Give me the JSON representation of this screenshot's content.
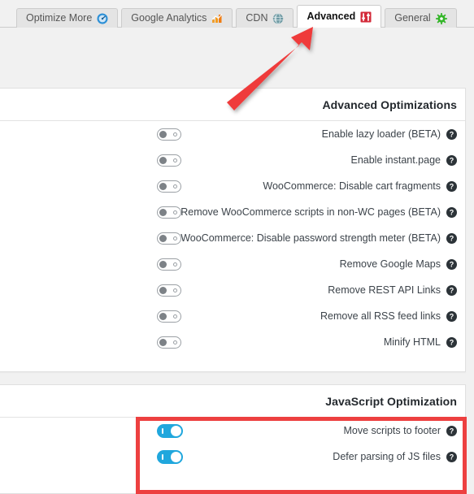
{
  "tabs": [
    {
      "label": "Optimize More",
      "icon": "speedometer-icon",
      "active": false
    },
    {
      "label": "Google Analytics",
      "icon": "chart-icon",
      "active": false
    },
    {
      "label": "CDN",
      "icon": "globe-icon",
      "active": false
    },
    {
      "label": "Advanced",
      "icon": "sliders-icon",
      "active": true
    },
    {
      "label": "General",
      "icon": "gear-icon",
      "active": false
    }
  ],
  "panels": [
    {
      "title": "Advanced Optimizations",
      "rows": [
        {
          "label": "Enable lazy loader (BETA)",
          "toggle": "off",
          "help": "help-icon"
        },
        {
          "label": "Enable instant.page",
          "toggle": "off",
          "help": "help-icon"
        },
        {
          "label": "WooCommerce: Disable cart fragments",
          "toggle": "off",
          "help": "help-icon"
        },
        {
          "label": "Remove WooCommerce scripts in non-WC pages (BETA)",
          "toggle": "off",
          "help": "help-icon"
        },
        {
          "label": "WooCommerce: Disable password strength meter (BETA)",
          "toggle": "off",
          "help": "help-icon"
        },
        {
          "label": "Remove Google Maps",
          "toggle": "off",
          "help": "help-icon"
        },
        {
          "label": "Remove REST API Links",
          "toggle": "off",
          "help": "help-icon"
        },
        {
          "label": "Remove all RSS feed links",
          "toggle": "off",
          "help": "help-icon"
        },
        {
          "label": "Minify HTML",
          "toggle": "off",
          "help": "help-icon"
        }
      ]
    },
    {
      "title": "JavaScript Optimization",
      "rows": [
        {
          "label": "Move scripts to footer",
          "toggle": "on",
          "help": "help-icon"
        },
        {
          "label": "Defer parsing of JS files",
          "toggle": "on",
          "help": "help-icon"
        }
      ]
    }
  ],
  "annotations": {
    "arrow": {
      "name": "red-arrow-annotation",
      "color": "#ef3b3b",
      "points_to": "Advanced"
    },
    "highlight_box": {
      "name": "red-highlight-box-annotation",
      "color": "#ed4040"
    }
  },
  "colors": {
    "toggle_on": "#20a7dd",
    "toggle_off_track": "#ffffff",
    "toggle_off_border": "#9ba0a5",
    "annotation_red": "#ed4040",
    "panel_bg": "#ffffff",
    "page_bg": "#f1f1f1",
    "title_text": "#23282d",
    "label_text": "#3c434a"
  }
}
